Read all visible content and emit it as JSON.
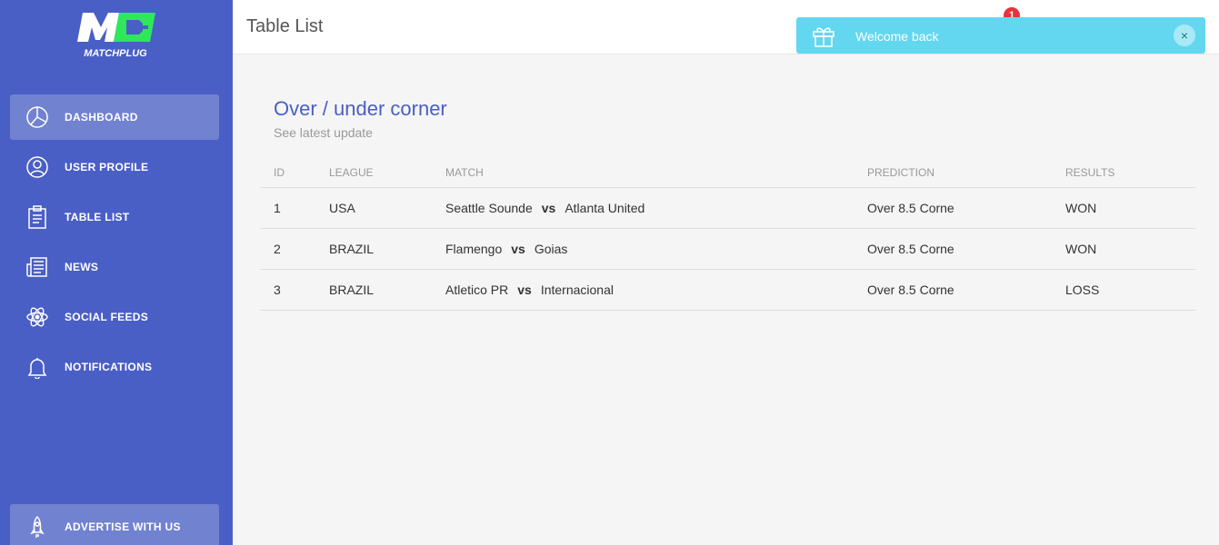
{
  "brand": {
    "logo_text": "MATCHPLUG",
    "logo_mark": "M",
    "accent": "#2ee85a"
  },
  "colors": {
    "sidebar": "#4a5fc5",
    "toast": "#63d7ef",
    "badge": "#e8323c",
    "title": "#4a5fc5"
  },
  "sidebar": {
    "items": [
      {
        "label": "DASHBOARD",
        "icon": "pie-chart-icon",
        "active": true
      },
      {
        "label": "USER PROFILE",
        "icon": "user-icon",
        "active": false
      },
      {
        "label": "TABLE LIST",
        "icon": "clipboard-icon",
        "active": false
      },
      {
        "label": "NEWS",
        "icon": "newspaper-icon",
        "active": false
      },
      {
        "label": "SOCIAL FEEDS",
        "icon": "atom-icon",
        "active": false
      },
      {
        "label": "NOTIFICATIONS",
        "icon": "bell-icon",
        "active": false
      }
    ],
    "advertise": {
      "label": "ADVERTISE WITH US",
      "icon": "rocket-icon"
    }
  },
  "header": {
    "title": "Table List",
    "notification_count": "1"
  },
  "toast": {
    "message": "Welcome back",
    "icon": "gift-icon",
    "close": "×"
  },
  "card": {
    "title": "Over / under corner",
    "subtitle": "See latest update",
    "columns": [
      "ID",
      "LEAGUE",
      "MATCH",
      "PREDICTION",
      "RESULTS"
    ],
    "vs_label": "vs",
    "rows": [
      {
        "id": "1",
        "league": "USA",
        "home": "Seattle Sounde",
        "away": "Atlanta United",
        "prediction": "Over 8.5 Corne",
        "result": "WON"
      },
      {
        "id": "2",
        "league": "BRAZIL",
        "home": "Flamengo",
        "away": "Goias",
        "prediction": "Over 8.5 Corne",
        "result": "WON"
      },
      {
        "id": "3",
        "league": "BRAZIL",
        "home": "Atletico PR",
        "away": "Internacional",
        "prediction": "Over 8.5 Corne",
        "result": "LOSS"
      }
    ]
  }
}
